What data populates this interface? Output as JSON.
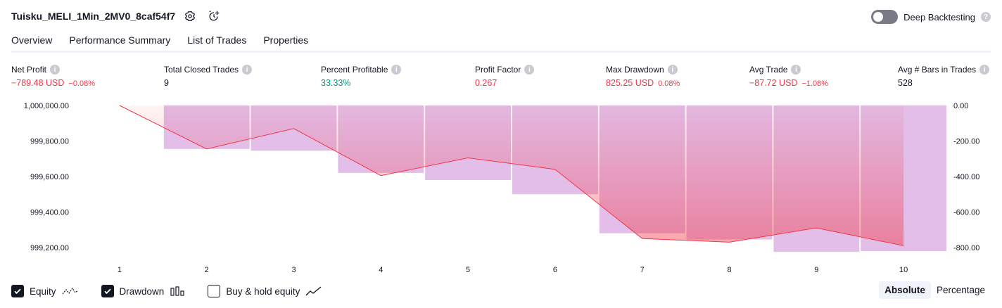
{
  "header": {
    "title": "Tuisku_MELI_1Min_2MV0_8caf54f7",
    "deep_backtesting_label": "Deep Backtesting",
    "deep_backtesting_enabled": false
  },
  "tabs": [
    {
      "label": "Overview",
      "active": true
    },
    {
      "label": "Performance Summary",
      "active": false
    },
    {
      "label": "List of Trades",
      "active": false
    },
    {
      "label": "Properties",
      "active": false
    }
  ],
  "metrics": {
    "net_profit": {
      "label": "Net Profit",
      "value": "−789.48 USD",
      "sub": "−0.08%"
    },
    "total_closed_trades": {
      "label": "Total Closed Trades",
      "value": "9"
    },
    "percent_profitable": {
      "label": "Percent Profitable",
      "value": "33.33%"
    },
    "profit_factor": {
      "label": "Profit Factor",
      "value": "0.267"
    },
    "max_drawdown": {
      "label": "Max Drawdown",
      "value": "825.25 USD",
      "sub": "0.08%"
    },
    "avg_trade": {
      "label": "Avg Trade",
      "value": "−87.72 USD",
      "sub": "−1.08%"
    },
    "avg_bars": {
      "label": "Avg # Bars in Trades",
      "value": "528"
    }
  },
  "chart_data": {
    "type": "line",
    "x": [
      1,
      2,
      3,
      4,
      5,
      6,
      7,
      8,
      9,
      10
    ],
    "equity": {
      "values": [
        1000000,
        999755,
        999870,
        999605,
        999705,
        999640,
        999250,
        999230,
        999310,
        999210
      ],
      "ylim": [
        999160,
        1000000
      ],
      "tick_labels": [
        "1,000,000.00",
        "999,800.00",
        "999,600.00",
        "999,400.00",
        "999,200.00"
      ],
      "tick_values": [
        1000000,
        999800,
        999600,
        999400,
        999200
      ],
      "color": "#f23645"
    },
    "drawdown": {
      "values": [
        0,
        -245,
        -255,
        -380,
        -420,
        -500,
        -720,
        -755,
        -825,
        -820
      ],
      "ylim": [
        -840,
        0
      ],
      "tick_labels": [
        "0.00",
        "-200.00",
        "-400.00",
        "-600.00",
        "-800.00"
      ],
      "tick_values": [
        0,
        -200,
        -400,
        -600,
        -800
      ],
      "color": "#ce93d8"
    },
    "grid": false
  },
  "legend": {
    "equity": {
      "label": "Equity",
      "checked": true
    },
    "drawdown": {
      "label": "Drawdown",
      "checked": true
    },
    "buy_hold": {
      "label": "Buy & hold equity",
      "checked": false
    }
  },
  "modes": {
    "absolute": "Absolute",
    "percentage": "Percentage",
    "selected": "Absolute"
  },
  "icons": {
    "settings": "gear-icon",
    "add_alert": "alarm-plus-icon",
    "help": "question-icon"
  }
}
